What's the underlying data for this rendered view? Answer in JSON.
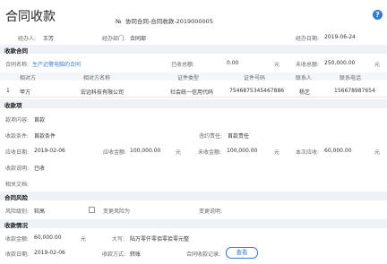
{
  "header": {
    "title": "合同收款",
    "doc_no_label": "№",
    "doc_no": "协同合同-合同收款-2019000005",
    "help_icon": "?",
    "handler_label": "经办人:",
    "handler": "王芳",
    "dept_label": "经办部门:",
    "dept": "合同部",
    "date_label": "经办日期:",
    "date": "2019-06-24"
  },
  "contract_section": {
    "title": "收款合同",
    "name_label": "合同名称:",
    "name": "生产迈警电脑的合同",
    "received_label": "已收总额:",
    "received": "0.00",
    "received_unit": "元",
    "pending_label": "未收总额:",
    "pending": "250,000.00",
    "pending_unit": "元",
    "columns": [
      "相对方",
      "相对方名称",
      "证件类型",
      "证件号码",
      "联系人",
      "联系电话"
    ],
    "rows": [
      {
        "index": "1",
        "party": "甲方",
        "name": "宏远科技有限公司",
        "id_type": "社会统一信用代码",
        "id_no": "7546875345467886",
        "contact": "杨艺",
        "phone": "156678987654"
      }
    ]
  },
  "receipt_section": {
    "title": "收款项",
    "content_label": "款项内容:",
    "content": "首款",
    "condition_label": "收款条件:",
    "condition": "首款条件",
    "breach_label": "违约责任:",
    "breach": "首款责任",
    "due_date_label": "应收日期:",
    "due_date": "2019-02-06",
    "total_label": "应收金额:",
    "total": "100,000.00",
    "total_unit": "元",
    "remaining_label": "未收金额:",
    "remaining": "100,000.00",
    "remaining_unit": "元",
    "this_label": "本次应收:",
    "this_amount": "60,000.00",
    "this_unit": "元",
    "note_label": "收款说明:",
    "note": "已收",
    "docs_label": "相关文档:"
  },
  "risk_section": {
    "title": "合同风险",
    "level_label": "风险级别:",
    "level": "较高",
    "change_label": "变更风险为",
    "change_note_label": "变更说明:"
  },
  "collection_section": {
    "title": "收款情况",
    "amount_label": "收款金额:",
    "amount": "60,000.00",
    "amount_unit": "元",
    "upper_label": "大写:",
    "upper": "陆万零仟零佰零拾零元整",
    "date_label": "收款日期:",
    "date": "2019-02-06",
    "method_label": "收款方式:",
    "method": "转账",
    "record_label": "合同收款记录:",
    "view_button": "查看"
  },
  "colors": {
    "accent": "#3a7bd5",
    "section_bg": "#eef1f6",
    "help": "#2e7bd6"
  }
}
